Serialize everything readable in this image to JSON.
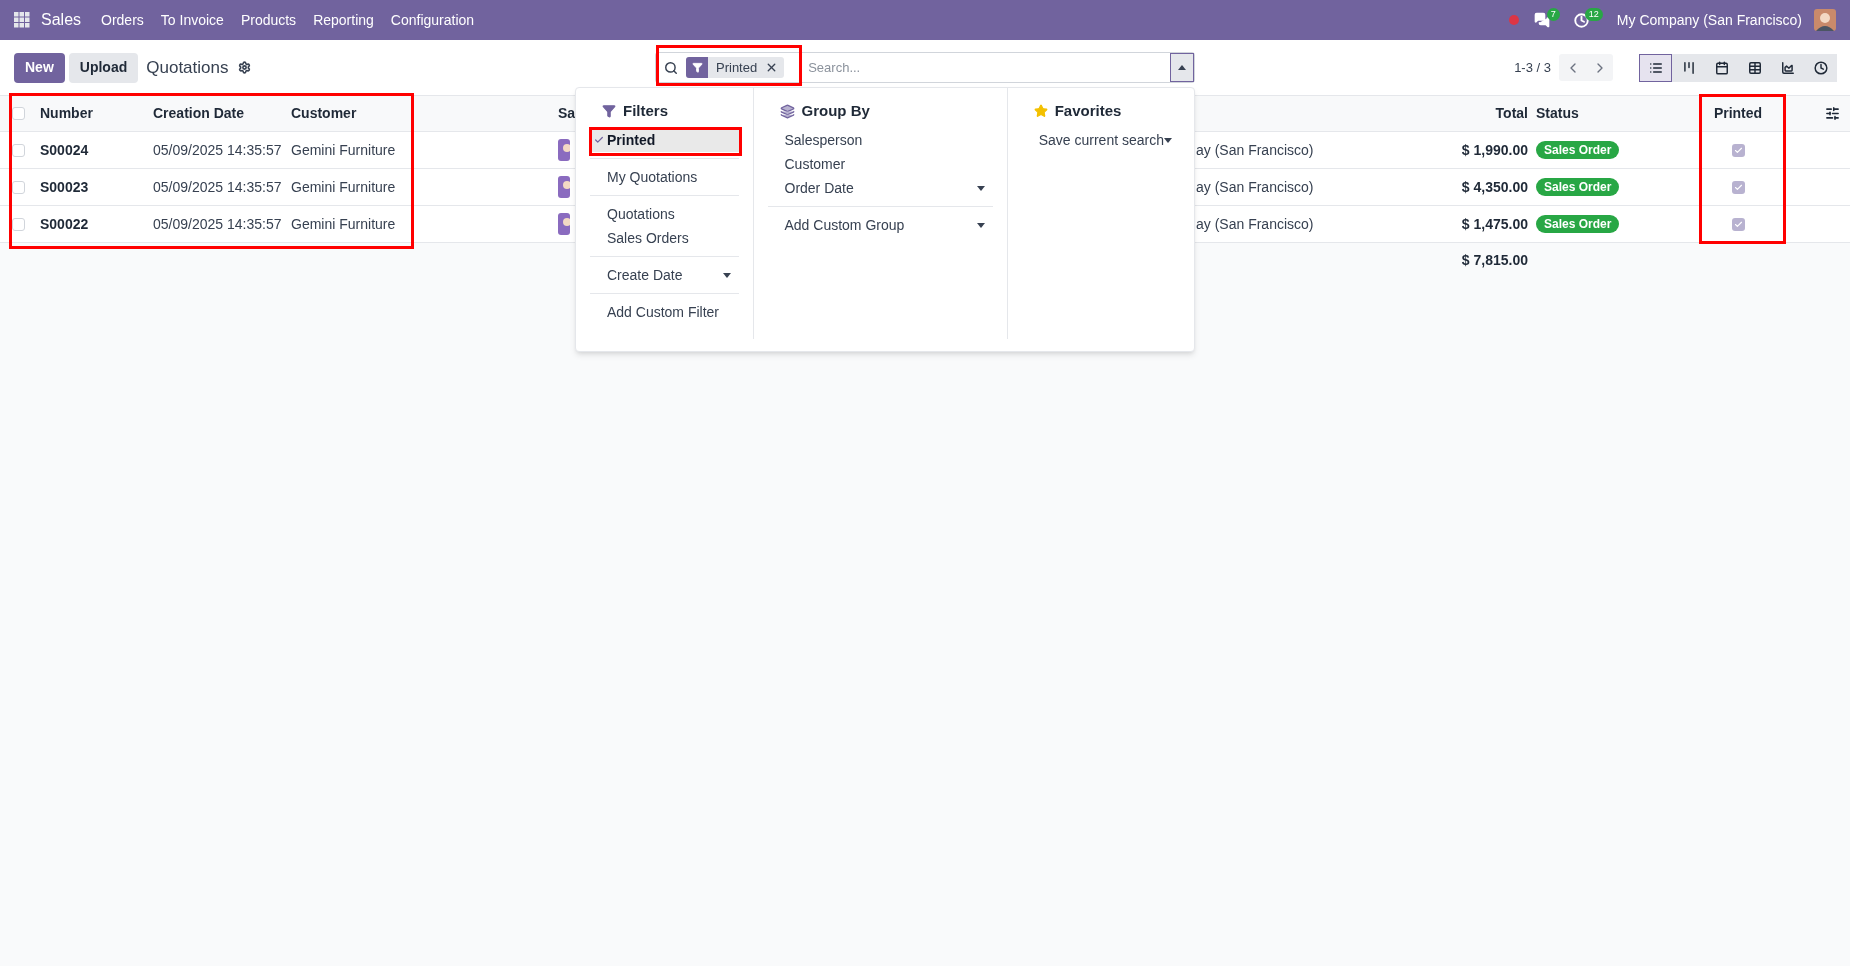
{
  "navbar": {
    "app": "Sales",
    "menu": [
      "Orders",
      "To Invoice",
      "Products",
      "Reporting",
      "Configuration"
    ],
    "chat_count": "7",
    "activity_count": "12",
    "company": "My Company (San Francisco)"
  },
  "control_panel": {
    "buttons": [
      {
        "label": "New",
        "kind": "primary"
      },
      {
        "label": "Upload",
        "kind": "secondary"
      }
    ],
    "title": "Quotations",
    "search": {
      "facets": [
        {
          "label": "Printed"
        }
      ],
      "placeholder": "Search...",
      "expanded": true
    },
    "pager": "1-3 / 3",
    "views": [
      {
        "kind": "list",
        "selected": true
      },
      {
        "kind": "kanban",
        "selected": false
      },
      {
        "kind": "calendar",
        "selected": false
      },
      {
        "kind": "pivot",
        "selected": false
      },
      {
        "kind": "graph",
        "selected": false
      },
      {
        "kind": "activity",
        "selected": false
      }
    ]
  },
  "table": {
    "columns": [
      "Number",
      "Creation Date",
      "Customer",
      "Sa",
      "Total",
      "Status",
      "Printed"
    ],
    "rows": [
      {
        "number": "S00024",
        "creation_date": "05/09/2025 14:35:57",
        "customer": "Gemini Furniture",
        "company": "ay (San Francisco)",
        "total": "$ 1,990.00",
        "status": "Sales Order",
        "printed": true,
        "selected": false
      },
      {
        "number": "S00023",
        "creation_date": "05/09/2025 14:35:57",
        "customer": "Gemini Furniture",
        "company": "ay (San Francisco)",
        "total": "$ 4,350.00",
        "status": "Sales Order",
        "printed": true,
        "selected": false
      },
      {
        "number": "S00022",
        "creation_date": "05/09/2025 14:35:57",
        "customer": "Gemini Furniture",
        "company": "ay (San Francisco)",
        "total": "$ 1,475.00",
        "status": "Sales Order",
        "printed": true,
        "selected": false
      }
    ],
    "sum_total": "$ 7,815.00",
    "all_selected": false
  },
  "search_panel": {
    "filters": {
      "title": "Filters",
      "groups": [
        [
          {
            "label": "Printed",
            "selected": true,
            "kind": "option"
          }
        ],
        [
          {
            "label": "My Quotations",
            "selected": false,
            "kind": "option"
          }
        ],
        [
          {
            "label": "Quotations",
            "selected": false,
            "kind": "option"
          },
          {
            "label": "Sales Orders",
            "selected": false,
            "kind": "option"
          }
        ],
        [
          {
            "label": "Create Date",
            "selected": false,
            "kind": "submenu"
          }
        ],
        [
          {
            "label": "Add Custom Filter",
            "selected": false,
            "kind": "option"
          }
        ]
      ]
    },
    "group_by": {
      "title": "Group By",
      "groups": [
        [
          {
            "label": "Salesperson",
            "selected": false,
            "kind": "option"
          },
          {
            "label": "Customer",
            "selected": false,
            "kind": "option"
          },
          {
            "label": "Order Date",
            "selected": false,
            "kind": "submenu"
          }
        ],
        [
          {
            "label": "Add Custom Group",
            "selected": false,
            "kind": "submenu"
          }
        ]
      ]
    },
    "favorites": {
      "title": "Favorites",
      "groups": [
        [
          {
            "label": "Save current search",
            "selected": false,
            "kind": "submenu"
          }
        ]
      ]
    }
  }
}
